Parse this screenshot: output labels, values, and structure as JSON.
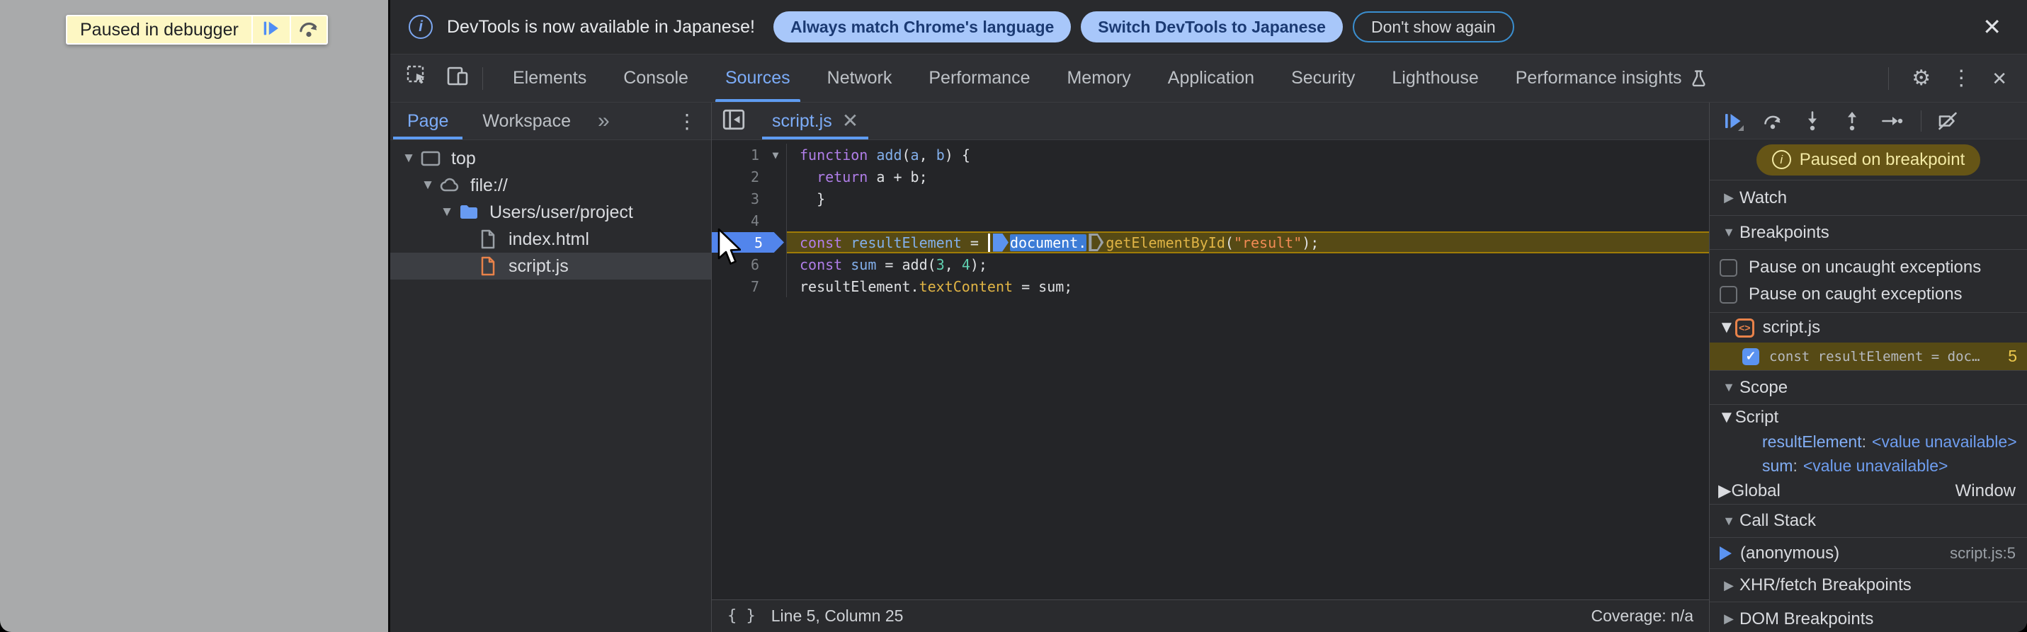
{
  "page_behind": {
    "paused_banner": {
      "text": "Paused in debugger",
      "buttons": [
        "resume",
        "step-over"
      ]
    }
  },
  "notification": {
    "message": "DevTools is now available in Japanese!",
    "buttons": [
      {
        "label": "Always match Chrome's language",
        "style": "filled"
      },
      {
        "label": "Switch DevTools to Japanese",
        "style": "filled"
      },
      {
        "label": "Don't show again",
        "style": "outlined"
      }
    ],
    "close": "✕"
  },
  "tabbar": {
    "tabs": [
      {
        "label": "Elements"
      },
      {
        "label": "Console"
      },
      {
        "label": "Sources",
        "active": true
      },
      {
        "label": "Network"
      },
      {
        "label": "Performance"
      },
      {
        "label": "Memory"
      },
      {
        "label": "Application"
      },
      {
        "label": "Security"
      },
      {
        "label": "Lighthouse"
      },
      {
        "label": "Performance insights",
        "icon": "flask"
      }
    ],
    "kebab": "⋮",
    "gear": "⚙",
    "close": "✕"
  },
  "navigator": {
    "tabs": [
      {
        "label": "Page",
        "active": true
      },
      {
        "label": "Workspace"
      }
    ],
    "more_symbol": "»",
    "kebab": "⋮",
    "tree": [
      {
        "depth": 0,
        "caret": "down",
        "icon": "frame",
        "label": "top"
      },
      {
        "depth": 1,
        "caret": "down",
        "icon": "cloud",
        "label": "file://"
      },
      {
        "depth": 2,
        "caret": "down",
        "icon": "folder",
        "label": "Users/user/project"
      },
      {
        "depth": 3,
        "caret": "none",
        "icon": "file-gray",
        "label": "index.html"
      },
      {
        "depth": 3,
        "caret": "none",
        "icon": "file-orange",
        "label": "script.js",
        "selected": true
      }
    ]
  },
  "editor": {
    "tab": {
      "label": "script.js",
      "close": "✕"
    },
    "paused_line": 5,
    "breakpoint_line": 5,
    "lines": [
      {
        "n": 1,
        "fold": "▼",
        "tokens": [
          {
            "t": "kw",
            "s": "function"
          },
          {
            "t": "pl",
            "s": " "
          },
          {
            "t": "def",
            "s": "add"
          },
          {
            "t": "pl",
            "s": "("
          },
          {
            "t": "def",
            "s": "a"
          },
          {
            "t": "pl",
            "s": ", "
          },
          {
            "t": "def",
            "s": "b"
          },
          {
            "t": "pl",
            "s": ") {"
          }
        ]
      },
      {
        "n": 2,
        "tokens": [
          {
            "t": "pl",
            "s": "  "
          },
          {
            "t": "kw",
            "s": "return"
          },
          {
            "t": "pl",
            "s": " a + b;"
          }
        ]
      },
      {
        "n": 3,
        "tokens": [
          {
            "t": "pl",
            "s": "  }"
          }
        ]
      },
      {
        "n": 4,
        "tokens": []
      },
      {
        "n": 5,
        "paused": true,
        "tokens": [
          {
            "t": "kw",
            "s": "const"
          },
          {
            "t": "pl",
            "s": " "
          },
          {
            "t": "def",
            "s": "resultElement"
          },
          {
            "t": "pl",
            "s": " = "
          },
          {
            "t": "caret"
          },
          {
            "t": "mkA"
          },
          {
            "t": "sel",
            "s": "document."
          },
          {
            "t": "mkI"
          },
          {
            "t": "prop",
            "s": "getElementById"
          },
          {
            "t": "pl",
            "s": "("
          },
          {
            "t": "str",
            "s": "\"result\""
          },
          {
            "t": "pl",
            "s": ");"
          }
        ]
      },
      {
        "n": 6,
        "tokens": [
          {
            "t": "kw",
            "s": "const"
          },
          {
            "t": "pl",
            "s": " "
          },
          {
            "t": "def",
            "s": "sum"
          },
          {
            "t": "pl",
            "s": " = add("
          },
          {
            "t": "num",
            "s": "3"
          },
          {
            "t": "pl",
            "s": ", "
          },
          {
            "t": "num",
            "s": "4"
          },
          {
            "t": "pl",
            "s": ");"
          }
        ]
      },
      {
        "n": 7,
        "tokens": [
          {
            "t": "pl",
            "s": "resultElement."
          },
          {
            "t": "prop",
            "s": "textContent"
          },
          {
            "t": "pl",
            "s": " = sum;"
          }
        ]
      }
    ],
    "status": {
      "braces": "{ }",
      "position": "Line 5, Column 25",
      "coverage": "Coverage: n/a"
    }
  },
  "debugger": {
    "toolbar_icons": [
      "resume",
      "step-over",
      "step-into",
      "step-out",
      "step",
      "deactivate-breakpoints"
    ],
    "badge": "Paused on breakpoint",
    "watch_label": "Watch",
    "breakpoints": {
      "label": "Breakpoints",
      "pause_uncaught": "Pause on uncaught exceptions",
      "pause_caught": "Pause on caught exceptions",
      "file": "script.js",
      "file_icon": "<>",
      "entry": {
        "code": "const resultElement = doc…",
        "line": "5",
        "checked": true
      }
    },
    "scope": {
      "label": "Scope",
      "script": {
        "label": "Script",
        "vars": [
          {
            "name": "resultElement",
            "value": "<value unavailable>"
          },
          {
            "name": "sum",
            "value": "<value unavailable>"
          }
        ]
      },
      "global": {
        "label": "Global",
        "value": "Window"
      }
    },
    "call_stack": {
      "label": "Call Stack",
      "frames": [
        {
          "name": "(anonymous)",
          "location": "script.js:5"
        }
      ]
    },
    "xhr_label": "XHR/fetch Breakpoints",
    "dom_label": "DOM Breakpoints"
  },
  "colors": {
    "accent_blue": "#7cacf8",
    "pill_bg": "#a8c7fa",
    "paused_line_bg": "#564a15",
    "paused_line_border": "#a07c06",
    "badge_bg": "#665516",
    "badge_text": "#f2e9a4",
    "keyword": "#b07ee8",
    "string": "#f28b54",
    "number": "#5fd0b0",
    "property": "#e0b445",
    "breakpoint_flag": "#5285ec",
    "selected_token_bg": "#3d7cd6"
  }
}
